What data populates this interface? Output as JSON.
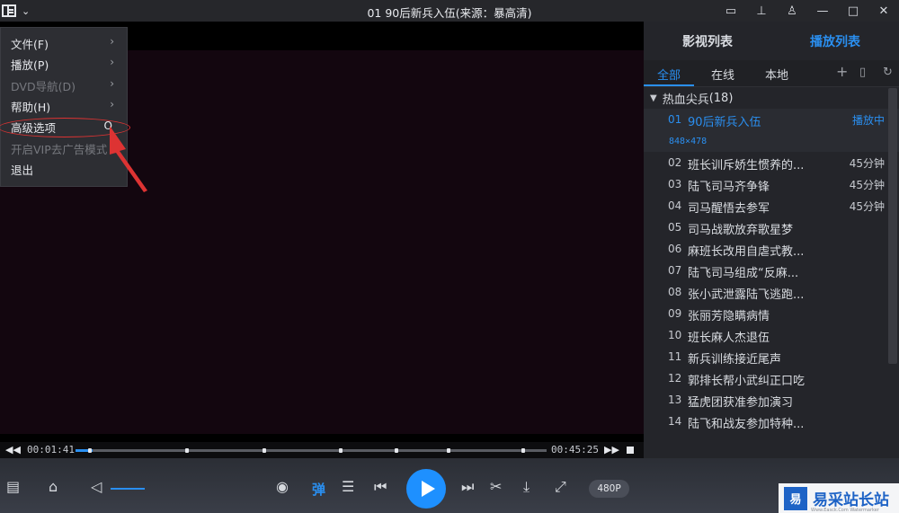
{
  "title": "01 90后新兵入伍(来源：暴高清)",
  "menu": {
    "items": [
      {
        "label": "文件(F)",
        "has_submenu": true,
        "disabled": false
      },
      {
        "label": "播放(P)",
        "has_submenu": true,
        "disabled": false
      },
      {
        "label": "DVD导航(D)",
        "has_submenu": true,
        "disabled": true
      },
      {
        "label": "帮助(H)",
        "has_submenu": true,
        "disabled": false
      },
      {
        "label": "高级选项",
        "shortcut": "O",
        "disabled": false
      },
      {
        "label": "开启VIP去广告模式",
        "disabled": true
      },
      {
        "label": "退出",
        "disabled": false
      }
    ]
  },
  "playback": {
    "current_time": "00:01:41",
    "total_time": "00:45:25",
    "progress_fraction": 0.037,
    "quality": "480P",
    "danmu_label": "弹"
  },
  "panel": {
    "tabs": [
      "影视列表",
      "播放列表"
    ],
    "subtabs": [
      "全部",
      "在线",
      "本地"
    ],
    "group": {
      "title": "热血尖兵",
      "count": "(18)"
    },
    "episodes": [
      {
        "num": "01",
        "title": "90后新兵入伍",
        "duration": "播放中",
        "current": true,
        "resolution": "848×478"
      },
      {
        "num": "02",
        "title": "班长训斥娇生惯养的...",
        "duration": "45分钟"
      },
      {
        "num": "03",
        "title": "陆飞司马齐争锋",
        "duration": "45分钟"
      },
      {
        "num": "04",
        "title": "司马醒悟去参军",
        "duration": "45分钟"
      },
      {
        "num": "05",
        "title": "司马战歌放弃歌星梦",
        "duration": ""
      },
      {
        "num": "06",
        "title": "麻班长改用自虐式教...",
        "duration": ""
      },
      {
        "num": "07",
        "title": "陆飞司马组成“反麻...",
        "duration": ""
      },
      {
        "num": "08",
        "title": "张小武泄露陆飞逃跑...",
        "duration": ""
      },
      {
        "num": "09",
        "title": "张丽芳隐瞒病情",
        "duration": ""
      },
      {
        "num": "10",
        "title": "班长麻人杰退伍",
        "duration": ""
      },
      {
        "num": "11",
        "title": "新兵训练接近尾声",
        "duration": ""
      },
      {
        "num": "12",
        "title": "郭排长帮小武纠正口吃",
        "duration": ""
      },
      {
        "num": "13",
        "title": "猛虎团获准参加演习",
        "duration": ""
      },
      {
        "num": "14",
        "title": "陆飞和战友参加特种...",
        "duration": ""
      }
    ]
  },
  "watermark": {
    "logo": "易",
    "text": "易采站长站",
    "sub": "Www.Easck.Com Watermarker"
  },
  "colors": {
    "accent": "#2a8ff0",
    "annotation": "#dd3333"
  }
}
